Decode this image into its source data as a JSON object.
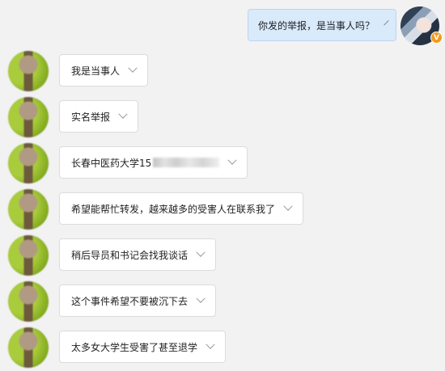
{
  "outgoing": {
    "text": "你发的举报，是当事人吗？"
  },
  "badge": {
    "label": "V",
    "color": "#f39a1e"
  },
  "messages": [
    {
      "text": "我是当事人"
    },
    {
      "text": "实名举报"
    },
    {
      "text": "长春中医药大学15"
    },
    {
      "text": "希望能帮忙转发，越来越多的受害人在联系我了"
    },
    {
      "text": "稍后导员和书记会找我谈话"
    },
    {
      "text": "这个事件希望不要被沉下去"
    },
    {
      "text": "太多女大学生受害了甚至退学"
    }
  ],
  "colors": {
    "background": "#f2f2f2",
    "outgoing_bubble": "#d9eafb",
    "incoming_bubble": "#ffffff"
  }
}
